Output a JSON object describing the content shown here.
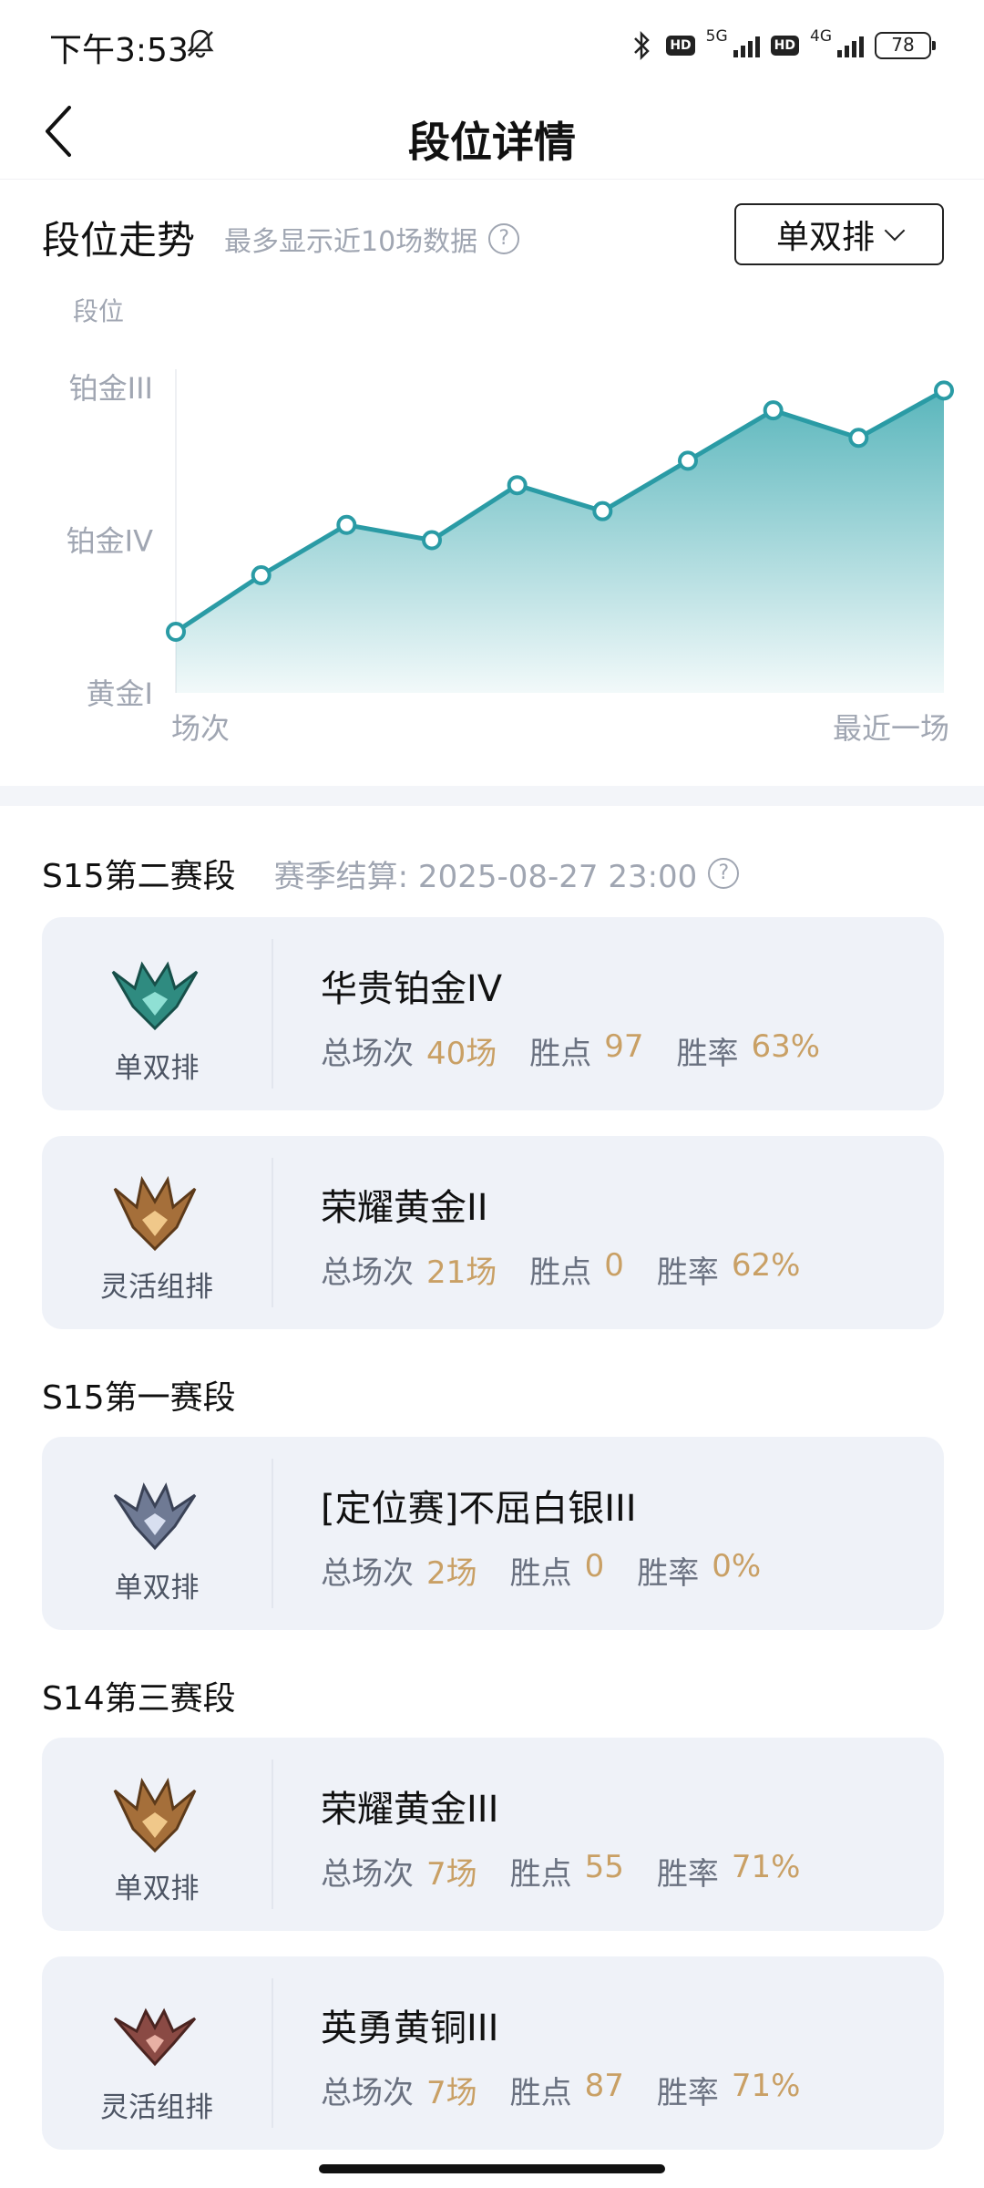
{
  "status_bar": {
    "time": "下午3:53",
    "net1": "5G",
    "net2": "4G",
    "hd": "HD",
    "battery": "78"
  },
  "header": {
    "title": "段位详情"
  },
  "trend": {
    "title": "段位走势",
    "hint": "最多显示近10场数据",
    "help": "?",
    "queue_select": "单双排"
  },
  "chart_data": {
    "type": "area",
    "ylabel": "段位",
    "ytick_labels": [
      "黄金I",
      "铂金IV",
      "铂金III"
    ],
    "x_start_label": "场次",
    "x_end_label": "最近一场",
    "y_range": [
      0,
      2
    ],
    "values": [
      0.4,
      0.77,
      1.1,
      1.0,
      1.36,
      1.19,
      1.52,
      1.85,
      1.67,
      1.98
    ],
    "line_color": "#2a9ba5",
    "fill_color": "#5ab6bc"
  },
  "seasons": [
    {
      "title": "S15第二赛段",
      "settle": "赛季结算: 2025-08-27 23:00",
      "help": "?",
      "cards": [
        {
          "mode": "单双排",
          "rank": "华贵铂金IV",
          "games_label": "总场次",
          "games": "40场",
          "points_label": "胜点",
          "points": "97",
          "rate_label": "胜率",
          "rate": "63%",
          "emblem": "platinum-emblem"
        },
        {
          "mode": "灵活组排",
          "rank": "荣耀黄金II",
          "games_label": "总场次",
          "games": "21场",
          "points_label": "胜点",
          "points": "0",
          "rate_label": "胜率",
          "rate": "62%",
          "emblem": "gold-emblem"
        }
      ]
    },
    {
      "title": "S15第一赛段",
      "cards": [
        {
          "mode": "单双排",
          "rank": "[定位赛]不屈白银III",
          "games_label": "总场次",
          "games": "2场",
          "points_label": "胜点",
          "points": "0",
          "rate_label": "胜率",
          "rate": "0%",
          "emblem": "silver-emblem"
        }
      ]
    },
    {
      "title": "S14第三赛段",
      "cards": [
        {
          "mode": "单双排",
          "rank": "荣耀黄金III",
          "games_label": "总场次",
          "games": "7场",
          "points_label": "胜点",
          "points": "55",
          "rate_label": "胜率",
          "rate": "71%",
          "emblem": "gold-emblem"
        },
        {
          "mode": "灵活组排",
          "rank": "英勇黄铜III",
          "games_label": "总场次",
          "games": "7场",
          "points_label": "胜点",
          "points": "87",
          "rate_label": "胜率",
          "rate": "71%",
          "emblem": "bronze-emblem"
        }
      ]
    }
  ]
}
